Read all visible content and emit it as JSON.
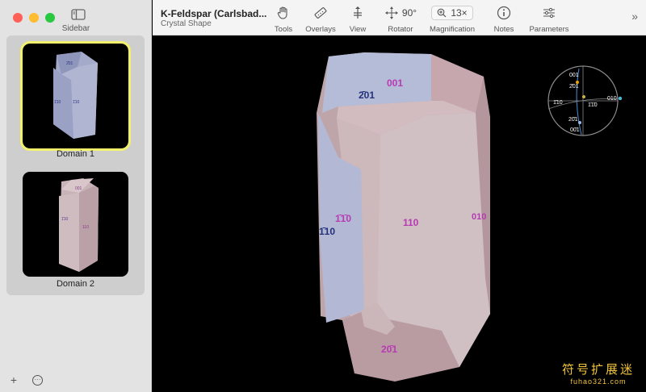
{
  "window": {
    "title": "K-Feldspar (Carlsbad...",
    "subtitle": "Crystal Shape"
  },
  "sidebar": {
    "label": "Sidebar",
    "domains": [
      {
        "name": "Domain 1",
        "selected": true
      },
      {
        "name": "Domain 2",
        "selected": false
      }
    ],
    "add_label": "+",
    "more_label": "···"
  },
  "toolbar": {
    "tools_label": "Tools",
    "overlays_label": "Overlays",
    "view_label": "View",
    "rotator_label": "Rotator",
    "rotator_value": "90°",
    "magnification_label": "Magnification",
    "magnification_value": "13×",
    "notes_label": "Notes",
    "parameters_label": "Parameters",
    "overflow_label": "»"
  },
  "crystal": {
    "face_labels": [
      "001",
      "2̄01",
      "1̄1̄0",
      "1̄10",
      "110",
      "010",
      "20̄1"
    ]
  },
  "stereonet": {
    "labels": [
      "001",
      "2̄01",
      "1̄10",
      "1̄1̄0",
      "010",
      "20̄1",
      "00̄1"
    ]
  },
  "watermark": {
    "chinese": "符号扩展迷",
    "url": "fuhao321.com"
  },
  "colors": {
    "selection_ring": "#f3f06b",
    "crystal_blue": "#b9bfd9",
    "crystal_pink": "#c9b0b5",
    "face_label_purple": "#b73ab3",
    "face_label_blue": "#25307a"
  }
}
